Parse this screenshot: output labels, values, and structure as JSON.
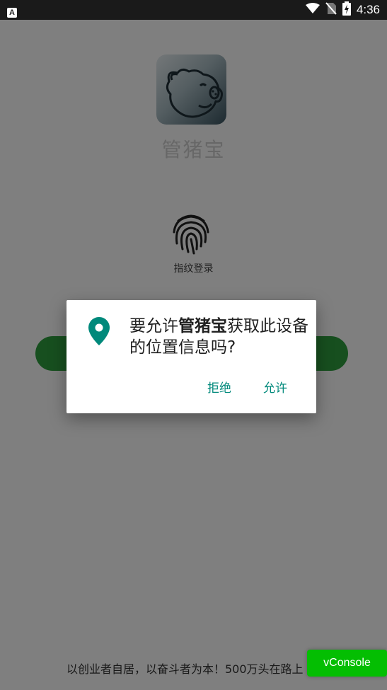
{
  "status_bar": {
    "left_icon_letter": "A",
    "time": "4:36",
    "icons": [
      "wifi-icon",
      "no-sim-icon",
      "battery-charging-icon"
    ]
  },
  "app": {
    "name": "管猪宝",
    "fingerprint_label": "指纹登录",
    "footer_slogan": "以创业者自居，以奋斗者为本！500万头在路上",
    "vconsole_label": "vConsole"
  },
  "dialog": {
    "icon": "location-pin-icon",
    "message_prefix": "要允许",
    "message_app": "管猪宝",
    "message_suffix": "获取此设备的位置信息吗?",
    "deny_label": "拒绝",
    "allow_label": "允许",
    "accent_color": "#00897b"
  },
  "colors": {
    "login_button": "#2e9e3e",
    "vconsole": "#04be02"
  }
}
